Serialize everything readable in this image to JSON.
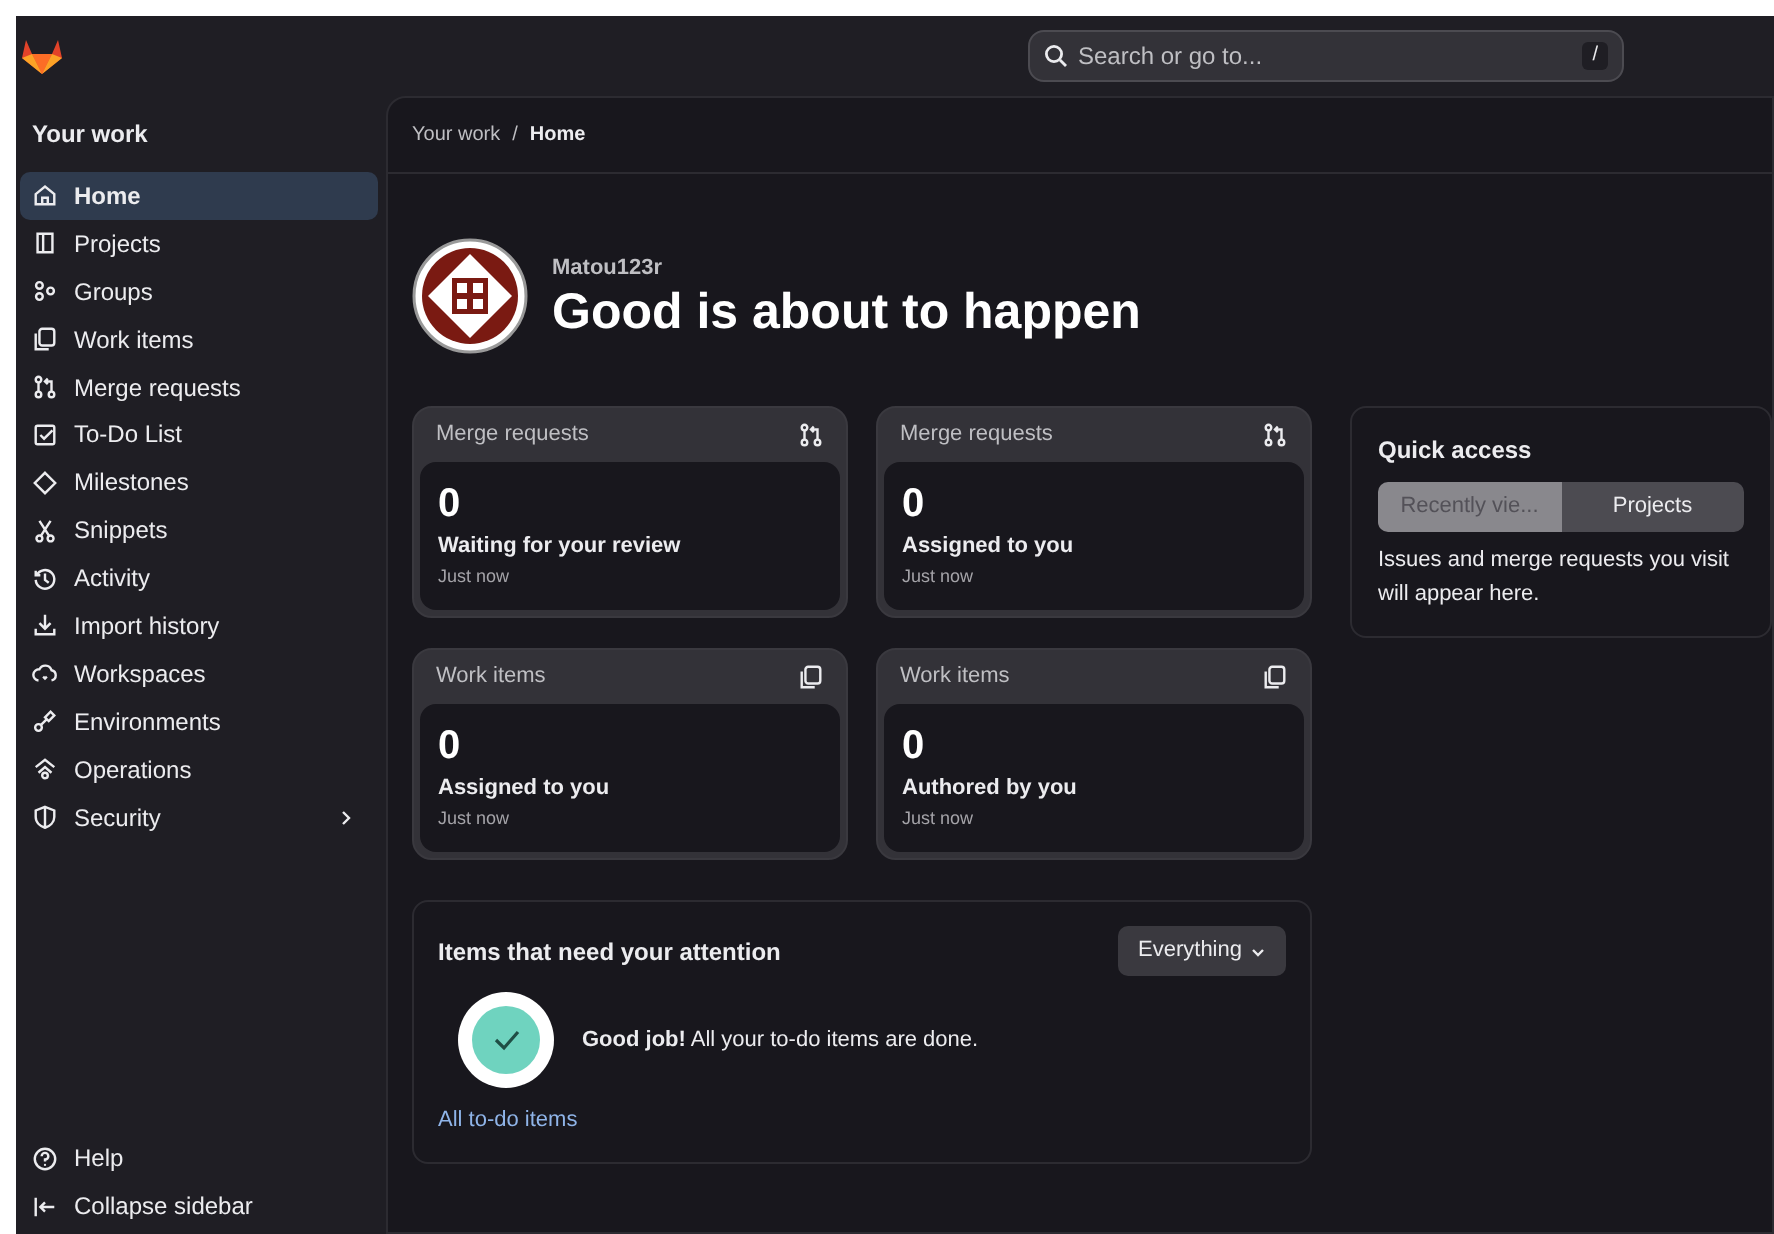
{
  "search": {
    "placeholder": "Search or go to...",
    "shortcut": "/"
  },
  "sidebar": {
    "title": "Your work",
    "items": [
      {
        "label": "Home",
        "selected": true,
        "submenu": false
      },
      {
        "label": "Projects",
        "selected": false,
        "submenu": false
      },
      {
        "label": "Groups",
        "selected": false,
        "submenu": false
      },
      {
        "label": "Work items",
        "selected": false,
        "submenu": false
      },
      {
        "label": "Merge requests",
        "selected": false,
        "submenu": false
      },
      {
        "label": "To-Do List",
        "selected": false,
        "submenu": false
      },
      {
        "label": "Milestones",
        "selected": false,
        "submenu": false
      },
      {
        "label": "Snippets",
        "selected": false,
        "submenu": false
      },
      {
        "label": "Activity",
        "selected": false,
        "submenu": false
      },
      {
        "label": "Import history",
        "selected": false,
        "submenu": false
      },
      {
        "label": "Workspaces",
        "selected": false,
        "submenu": false
      },
      {
        "label": "Environments",
        "selected": false,
        "submenu": false
      },
      {
        "label": "Operations",
        "selected": false,
        "submenu": false
      },
      {
        "label": "Security",
        "selected": false,
        "submenu": true
      }
    ],
    "footer": [
      {
        "label": "Help"
      },
      {
        "label": "Collapse sidebar"
      }
    ]
  },
  "breadcrumb": {
    "separator": "/",
    "items": [
      {
        "label": "Your work",
        "current": false
      },
      {
        "label": "Home",
        "current": true
      }
    ]
  },
  "greeting": {
    "username": "Matou123r",
    "heading": "Good is about to happen"
  },
  "cards": [
    {
      "kind": "merge",
      "title": "Merge requests",
      "count": "0",
      "label": "Waiting for your review",
      "time": "Just now"
    },
    {
      "kind": "merge",
      "title": "Merge requests",
      "count": "0",
      "label": "Assigned to you",
      "time": "Just now"
    },
    {
      "kind": "work",
      "title": "Work items",
      "count": "0",
      "label": "Assigned to you",
      "time": "Just now"
    },
    {
      "kind": "work",
      "title": "Work items",
      "count": "0",
      "label": "Authored by you",
      "time": "Just now"
    }
  ],
  "attention": {
    "title": "Items that need your attention",
    "filter": "Everything",
    "message": "**Good job!** All your to-do items are done.",
    "link": "All to-do items"
  },
  "quick_access": {
    "title": "Quick access",
    "tabs": [
      {
        "label": "Recently vie...",
        "selected": true
      },
      {
        "label": "Projects",
        "selected": false
      }
    ],
    "message": "Issues and merge requests you visit will appear here."
  }
}
